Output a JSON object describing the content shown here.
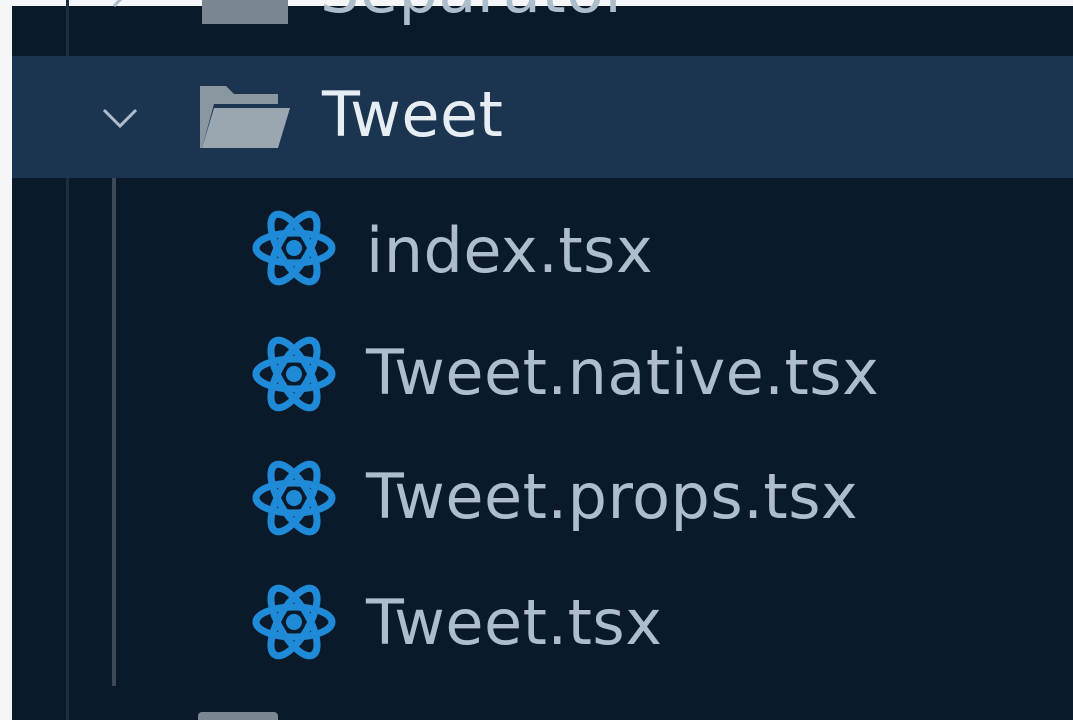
{
  "explorer": {
    "prev_folder": {
      "label": "Separator"
    },
    "current_folder": {
      "label": "Tweet",
      "expanded": true,
      "files": [
        {
          "label": "index.tsx",
          "icon": "react-icon"
        },
        {
          "label": "Tweet.native.tsx",
          "icon": "react-icon"
        },
        {
          "label": "Tweet.props.tsx",
          "icon": "react-icon"
        },
        {
          "label": "Tweet.tsx",
          "icon": "react-icon"
        }
      ]
    }
  },
  "colors": {
    "background": "#0b1a2a",
    "selected_row": "#1b3550",
    "react_blue": "#1e8ad8",
    "text": "#aebdcb",
    "folder": "#8a96a0"
  }
}
